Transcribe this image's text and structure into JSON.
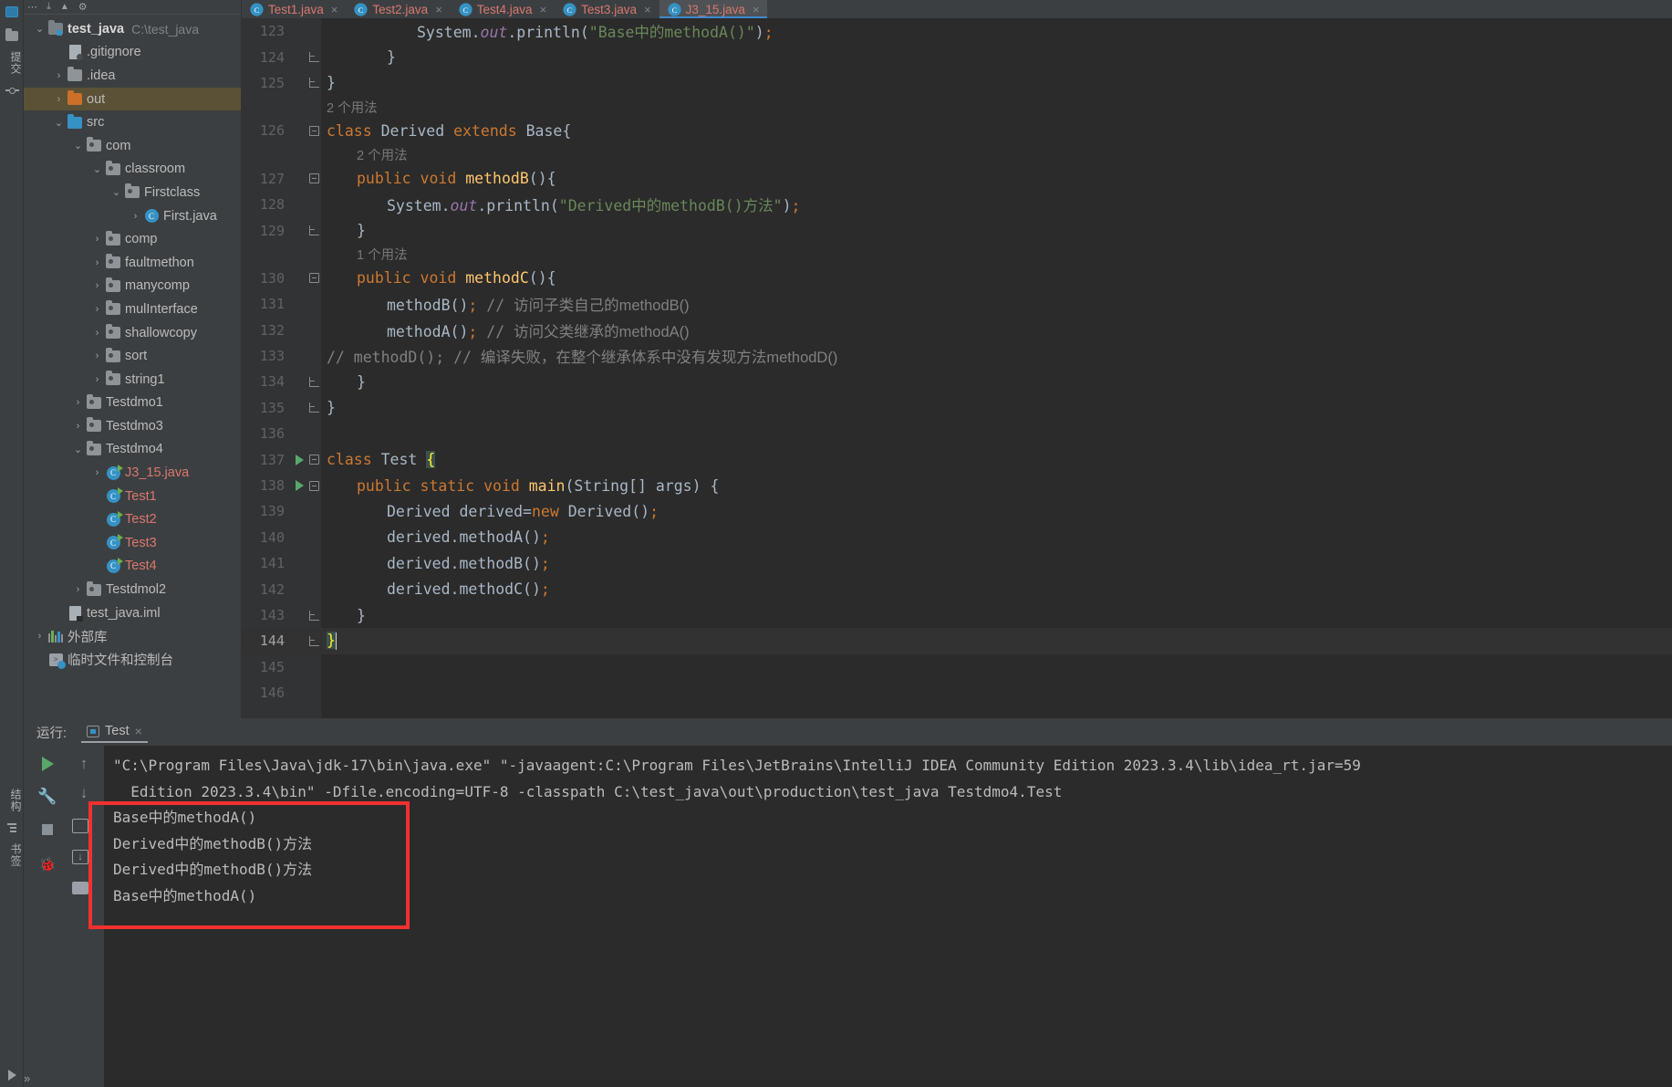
{
  "window": {
    "ide": "IntelliJ IDEA Community Edition 2023.3.4"
  },
  "rail": {
    "top_icons": [
      "project-icon",
      "folder-icon"
    ],
    "labels": {
      "commit": "提交",
      "structure": "结构",
      "bookmarks": "书签"
    },
    "expand_label": "»"
  },
  "project": {
    "toolbar_icons": [
      "more-icon",
      "collapse-all-icon",
      "expand-icon",
      "settings-icon"
    ],
    "tree": [
      {
        "indent": 0,
        "arrow": "down",
        "icon": "module-icon",
        "label": "test_java",
        "sub": "C:\\test_java",
        "bold": true
      },
      {
        "indent": 1,
        "arrow": "none",
        "icon": "gitignore-icon",
        "label": ".gitignore"
      },
      {
        "indent": 1,
        "arrow": "right",
        "icon": "folder-gray",
        "label": ".idea"
      },
      {
        "indent": 1,
        "arrow": "right",
        "icon": "folder-orange",
        "label": "out",
        "selected": true
      },
      {
        "indent": 1,
        "arrow": "down",
        "icon": "folder-blue",
        "label": "src"
      },
      {
        "indent": 2,
        "arrow": "down",
        "icon": "package-icon",
        "label": "com"
      },
      {
        "indent": 3,
        "arrow": "down",
        "icon": "package-icon",
        "label": "classroom"
      },
      {
        "indent": 4,
        "arrow": "down",
        "icon": "package-icon",
        "label": "Firstclass"
      },
      {
        "indent": 5,
        "arrow": "right",
        "icon": "java-class-icon",
        "label": "First.java"
      },
      {
        "indent": 3,
        "arrow": "right",
        "icon": "package-icon",
        "label": "comp"
      },
      {
        "indent": 3,
        "arrow": "right",
        "icon": "package-icon",
        "label": "faultmethon"
      },
      {
        "indent": 3,
        "arrow": "right",
        "icon": "package-icon",
        "label": "manycomp"
      },
      {
        "indent": 3,
        "arrow": "right",
        "icon": "package-icon",
        "label": "mulInterface"
      },
      {
        "indent": 3,
        "arrow": "right",
        "icon": "package-icon",
        "label": "shallowcopy"
      },
      {
        "indent": 3,
        "arrow": "right",
        "icon": "package-icon",
        "label": "sort"
      },
      {
        "indent": 3,
        "arrow": "right",
        "icon": "package-icon",
        "label": "string1"
      },
      {
        "indent": 2,
        "arrow": "right",
        "icon": "package-icon",
        "label": "Testdmo1"
      },
      {
        "indent": 2,
        "arrow": "right",
        "icon": "package-icon",
        "label": "Testdmo3"
      },
      {
        "indent": 2,
        "arrow": "down",
        "icon": "package-icon",
        "label": "Testdmo4"
      },
      {
        "indent": 3,
        "arrow": "right",
        "icon": "java-run-icon",
        "label": "J3_15.java",
        "red": true
      },
      {
        "indent": 3,
        "arrow": "none",
        "icon": "java-run-icon",
        "label": "Test1",
        "red": true
      },
      {
        "indent": 3,
        "arrow": "none",
        "icon": "java-run-icon",
        "label": "Test2",
        "red": true
      },
      {
        "indent": 3,
        "arrow": "none",
        "icon": "java-run-icon",
        "label": "Test3",
        "red": true
      },
      {
        "indent": 3,
        "arrow": "none",
        "icon": "java-run-icon",
        "label": "Test4",
        "red": true
      },
      {
        "indent": 2,
        "arrow": "right",
        "icon": "package-icon",
        "label": "Testdmol2"
      },
      {
        "indent": 1,
        "arrow": "none",
        "icon": "iml-icon",
        "label": "test_java.iml"
      },
      {
        "indent": 0,
        "arrow": "right",
        "icon": "library-icon",
        "label": "外部库"
      },
      {
        "indent": 0,
        "arrow": "none",
        "icon": "scratch-icon",
        "label": "临时文件和控制台"
      }
    ]
  },
  "editor": {
    "tabs": [
      {
        "label": "Test1.java",
        "active": false
      },
      {
        "label": "Test2.java",
        "active": false
      },
      {
        "label": "Test4.java",
        "active": false
      },
      {
        "label": "Test3.java",
        "active": false
      },
      {
        "label": "J3_15.java",
        "active": true
      }
    ],
    "lines": [
      {
        "num": "123",
        "indent": 3,
        "segs": [
          {
            "t": "System",
            "c": "cls"
          },
          {
            "t": ".",
            "c": "punc"
          },
          {
            "t": "out",
            "c": "fld"
          },
          {
            "t": ".println(",
            "c": "punc"
          },
          {
            "t": "\"Base中的methodA()\"",
            "c": "str"
          },
          {
            "t": ")",
            "c": "punc"
          },
          {
            "t": ";",
            "c": "semi"
          }
        ]
      },
      {
        "num": "124",
        "indent": 2,
        "fold": "end",
        "segs": [
          {
            "t": "}",
            "c": "punc"
          }
        ]
      },
      {
        "num": "125",
        "indent": 0,
        "fold": "end",
        "segs": [
          {
            "t": "}",
            "c": "punc"
          }
        ]
      },
      {
        "hint": "2 个用法",
        "hint_indent": 0
      },
      {
        "num": "126",
        "indent": 0,
        "fold": "minus",
        "segs": [
          {
            "t": "class ",
            "c": "kw"
          },
          {
            "t": "Derived ",
            "c": "cls"
          },
          {
            "t": "extends ",
            "c": "kw"
          },
          {
            "t": "Base{",
            "c": "cls"
          }
        ]
      },
      {
        "hint": "2 个用法",
        "hint_indent": 1
      },
      {
        "num": "127",
        "indent": 1,
        "fold": "minus",
        "segs": [
          {
            "t": "public void ",
            "c": "kw"
          },
          {
            "t": "methodB",
            "c": "fn"
          },
          {
            "t": "(){",
            "c": "punc"
          }
        ]
      },
      {
        "num": "128",
        "indent": 2,
        "segs": [
          {
            "t": "System",
            "c": "cls"
          },
          {
            "t": ".",
            "c": "punc"
          },
          {
            "t": "out",
            "c": "fld"
          },
          {
            "t": ".println(",
            "c": "punc"
          },
          {
            "t": "\"Derived中的methodB()方法\"",
            "c": "str"
          },
          {
            "t": ")",
            "c": "punc"
          },
          {
            "t": ";",
            "c": "semi"
          }
        ]
      },
      {
        "num": "129",
        "indent": 1,
        "fold": "end",
        "segs": [
          {
            "t": "}",
            "c": "punc"
          }
        ]
      },
      {
        "hint": "1 个用法",
        "hint_indent": 1
      },
      {
        "num": "130",
        "indent": 1,
        "fold": "minus",
        "segs": [
          {
            "t": "public void ",
            "c": "kw"
          },
          {
            "t": "methodC",
            "c": "fn"
          },
          {
            "t": "(){",
            "c": "punc"
          }
        ]
      },
      {
        "num": "131",
        "indent": 2,
        "segs": [
          {
            "t": "methodB()",
            "c": "punc"
          },
          {
            "t": ";",
            "c": "semi"
          },
          {
            "t": " // ",
            "c": "cm-mono"
          },
          {
            "t": "访问子类自己的methodB()",
            "c": "cm"
          }
        ]
      },
      {
        "num": "132",
        "indent": 2,
        "segs": [
          {
            "t": "methodA()",
            "c": "punc"
          },
          {
            "t": ";",
            "c": "semi"
          },
          {
            "t": " // ",
            "c": "cm-mono"
          },
          {
            "t": "访问父类继承的methodA()",
            "c": "cm"
          }
        ]
      },
      {
        "num": "133",
        "indent": 0,
        "segs": [
          {
            "t": "// methodD(); // ",
            "c": "cm-mono"
          },
          {
            "t": "编译失败，在整个继承体系中没有发现方法methodD()",
            "c": "cm"
          }
        ]
      },
      {
        "num": "134",
        "indent": 1,
        "fold": "end",
        "segs": [
          {
            "t": "}",
            "c": "punc"
          }
        ]
      },
      {
        "num": "135",
        "indent": 0,
        "fold": "end",
        "segs": [
          {
            "t": "}",
            "c": "punc"
          }
        ]
      },
      {
        "num": "136",
        "indent": 0,
        "segs": []
      },
      {
        "num": "137",
        "indent": 0,
        "run": true,
        "fold": "minus",
        "segs": [
          {
            "t": "class ",
            "c": "kw"
          },
          {
            "t": "Test ",
            "c": "cls"
          },
          {
            "t": "{",
            "c": "brace-hl"
          }
        ]
      },
      {
        "num": "138",
        "indent": 1,
        "run": true,
        "fold": "minus",
        "segs": [
          {
            "t": "public static void ",
            "c": "kw"
          },
          {
            "t": "main",
            "c": "fn"
          },
          {
            "t": "(String[] args) {",
            "c": "punc"
          }
        ]
      },
      {
        "num": "139",
        "indent": 2,
        "segs": [
          {
            "t": "Derived derived=",
            "c": "punc"
          },
          {
            "t": "new ",
            "c": "kw"
          },
          {
            "t": "Derived()",
            "c": "punc"
          },
          {
            "t": ";",
            "c": "semi"
          }
        ]
      },
      {
        "num": "140",
        "indent": 2,
        "segs": [
          {
            "t": "derived.methodA()",
            "c": "punc"
          },
          {
            "t": ";",
            "c": "semi"
          }
        ]
      },
      {
        "num": "141",
        "indent": 2,
        "segs": [
          {
            "t": "derived.methodB()",
            "c": "punc"
          },
          {
            "t": ";",
            "c": "semi"
          }
        ]
      },
      {
        "num": "142",
        "indent": 2,
        "segs": [
          {
            "t": "derived.methodC()",
            "c": "punc"
          },
          {
            "t": ";",
            "c": "semi"
          }
        ]
      },
      {
        "num": "143",
        "indent": 1,
        "fold": "end",
        "segs": [
          {
            "t": "}",
            "c": "punc"
          }
        ]
      },
      {
        "num": "144",
        "indent": 0,
        "current": true,
        "fold": "end",
        "segs": [
          {
            "t": "}",
            "c": "brace-hl"
          }
        ]
      },
      {
        "num": "145",
        "indent": 0,
        "segs": []
      },
      {
        "num": "146",
        "indent": 0,
        "segs": []
      }
    ]
  },
  "run_panel": {
    "title": "运行:",
    "tab_label": "Test",
    "close_label": "×",
    "side_icons": [
      "run-icon",
      "arrow-up-icon",
      "wrench-icon",
      "stop-icon",
      "rerun-icon",
      "scroll-end-icon",
      "bug-icon",
      "print-icon"
    ],
    "console_lines": [
      "\"C:\\Program Files\\Java\\jdk-17\\bin\\java.exe\" \"-javaagent:C:\\Program Files\\JetBrains\\IntelliJ IDEA Community Edition 2023.3.4\\lib\\idea_rt.jar=59",
      "  Edition 2023.3.4\\bin\" -Dfile.encoding=UTF-8 -classpath C:\\test_java\\out\\production\\test_java Testdmo4.Test",
      "Base中的methodA()",
      "Derived中的methodB()方法",
      "Derived中的methodB()方法",
      "Base中的methodA()"
    ]
  },
  "colors": {
    "accent": "#3592c4",
    "highlight_box": "#f23030",
    "selection": "#5b5136",
    "keyword": "#cc7832",
    "string": "#6a8759",
    "method": "#ffc66d"
  }
}
